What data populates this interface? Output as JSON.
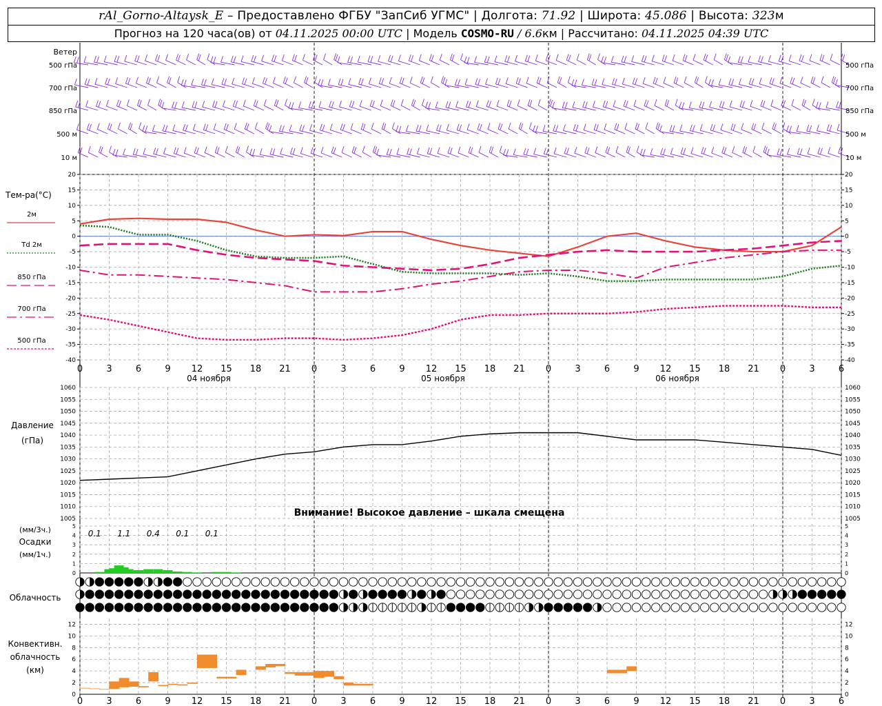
{
  "header": {
    "station": "rAl_Gorno-Altaysk_E",
    "provider_sep": " – ",
    "provider": "Предоставлено ФГБУ \"ЗапСиб УГМС\"",
    "sep": " | ",
    "lon_label": "Долгота: ",
    "lon_value": "71.92",
    "lat_label": "Широта: ",
    "lat_value": "45.086",
    "alt_label": "Высота: ",
    "alt_value": "323",
    "alt_unit": "м",
    "forecast_label": "Прогноз на 120 часа(ов)  от ",
    "forecast_start": "04.11.2025 00:00 UTC",
    "model_label": "Модель ",
    "model_name": "COSMO-RU",
    "model_res_sep": " / ",
    "model_res": "6.6",
    "model_res_unit": "км",
    "computed_label": "Рассчитано: ",
    "computed_value": "04.11.2025 04:39 UTC"
  },
  "wind": {
    "title": "Ветер",
    "levels": [
      "500 гПа",
      "700 гПа",
      "850 гПа",
      "500 м",
      "10  м"
    ],
    "barb_color": "#8a2be2"
  },
  "temperature": {
    "title": "Тем-ра(°C)",
    "legend": [
      {
        "label": "2м",
        "color": "#e8453c",
        "style": "solid"
      },
      {
        "label": "Td  2м",
        "color": "#1f7a1f",
        "style": "dotted"
      },
      {
        "label": "850 гПа",
        "color": "#e0127a",
        "style": "dash"
      },
      {
        "label": "700 гПа",
        "color": "#e0127a",
        "style": "dashdot"
      },
      {
        "label": "500 гПа",
        "color": "#e0127a",
        "style": "dot"
      }
    ],
    "y_ticks": [
      20,
      15,
      10,
      5,
      0,
      -5,
      -10,
      -15,
      -20,
      -25,
      -30,
      -35,
      -40
    ],
    "ylim": [
      -40,
      20
    ]
  },
  "time_axis": {
    "ticks": [
      "0",
      "3",
      "6",
      "9",
      "12",
      "15",
      "18",
      "21",
      "0",
      "3",
      "6",
      "9",
      "12",
      "15",
      "18",
      "21",
      "0",
      "3",
      "6",
      "9",
      "12",
      "15",
      "18",
      "21",
      "0",
      "3",
      "6"
    ],
    "day_labels": [
      "04 ноября",
      "05 ноября",
      "06 ноября"
    ]
  },
  "pressure": {
    "title": "Давление",
    "unit": "(гПа)",
    "y_ticks": [
      1060,
      1055,
      1050,
      1045,
      1040,
      1035,
      1030,
      1025,
      1020,
      1015,
      1010,
      1005
    ],
    "warning": "Внимание! Высокое давление – шкала смещена"
  },
  "precip": {
    "unit3": "(мм/3ч.)",
    "title": "Осадки",
    "unit1": "(мм/1ч.)",
    "totals": [
      "0.1",
      "1.1",
      "0.4",
      "0.1",
      "0.1"
    ],
    "y_ticks": [
      5,
      4,
      3,
      2,
      1,
      0
    ],
    "color": "#22cc22"
  },
  "cloud": {
    "title": "Облачность"
  },
  "convective": {
    "title_lines": [
      "Конвективн.",
      "облачность",
      "(км)"
    ],
    "y_ticks": [
      12,
      10,
      8,
      6,
      4,
      2,
      0
    ],
    "color": "#f08c2e"
  },
  "chart_data": [
    {
      "type": "line",
      "title": "Тем-ра(°C)",
      "x": [
        0,
        3,
        6,
        9,
        12,
        15,
        18,
        21,
        24,
        27,
        30,
        33,
        36,
        39,
        42,
        45,
        48,
        51,
        54,
        57,
        60,
        63,
        66,
        69,
        72,
        75,
        78
      ],
      "ylim": [
        -40,
        20
      ],
      "series": [
        {
          "name": "2м",
          "values": [
            4,
            5.5,
            5.8,
            5.5,
            5.5,
            4.5,
            2,
            0,
            0.5,
            0.2,
            1.5,
            1.5,
            -1,
            -3,
            -4.5,
            -5.5,
            -6.5,
            -3.5,
            0,
            1,
            -1.5,
            -3.5,
            -4.5,
            -5,
            -5,
            -3,
            3
          ]
        },
        {
          "name": "Td  2м",
          "values": [
            3.5,
            3,
            0.5,
            0.5,
            -1.5,
            -4.5,
            -6.5,
            -7,
            -7,
            -6.5,
            -9,
            -11.5,
            -12,
            -12,
            -12,
            -12.5,
            -12,
            -13,
            -14.5,
            -14.5,
            -14,
            -14,
            -14,
            -14,
            -13,
            -10.5,
            -9.5
          ]
        },
        {
          "name": "850 гПа",
          "values": [
            -3,
            -2.5,
            -2.5,
            -2.5,
            -4.5,
            -6,
            -7,
            -7.5,
            -8,
            -9.5,
            -10,
            -10.5,
            -11,
            -10.5,
            -9,
            -7,
            -6,
            -5,
            -4.5,
            -5,
            -5,
            -5,
            -4.5,
            -4,
            -3,
            -2,
            -1.5
          ]
        },
        {
          "name": "700 гПа",
          "values": [
            -11,
            -12.5,
            -12.5,
            -13,
            -13.5,
            -14,
            -15,
            -16,
            -18,
            -18,
            -18,
            -17,
            -15.5,
            -14.5,
            -13,
            -11.5,
            -11,
            -11,
            -12,
            -13.5,
            -10,
            -8.5,
            -7,
            -6,
            -5,
            -4.5,
            -4.5
          ]
        },
        {
          "name": "500 гПа",
          "values": [
            -25.5,
            -27,
            -29,
            -31,
            -33,
            -33.5,
            -33.5,
            -33,
            -33,
            -33.5,
            -33,
            -32,
            -30,
            -27,
            -25.5,
            -25.5,
            -25,
            -25,
            -25,
            -24.5,
            -23.5,
            -23,
            -22.5,
            -22.5,
            -22.5,
            -23,
            -23
          ]
        }
      ]
    },
    {
      "type": "line",
      "title": "Давление",
      "x": [
        0,
        3,
        6,
        9,
        12,
        15,
        18,
        21,
        24,
        27,
        30,
        33,
        36,
        39,
        42,
        45,
        48,
        51,
        54,
        57,
        60,
        63,
        66,
        69,
        72,
        75,
        78
      ],
      "ylim": [
        1005,
        1060
      ],
      "series": [
        {
          "values": [
            1021,
            1021.5,
            1022,
            1022.5,
            1025,
            1027.5,
            1030,
            1032,
            1033,
            1035,
            1036,
            1036,
            1037.5,
            1039.5,
            1040.5,
            1041,
            1041,
            1041,
            1039.5,
            1038,
            1038,
            1038,
            1037,
            1036,
            1035,
            1034,
            1031.5
          ]
        }
      ]
    },
    {
      "type": "bar",
      "title": "Осадки",
      "x": [
        2,
        3,
        3.5,
        4,
        4.5,
        5,
        6,
        7,
        8,
        9,
        10,
        11,
        12,
        14,
        15,
        16
      ],
      "ylim": [
        0,
        5
      ],
      "values": [
        0.1,
        0.4,
        0.5,
        0.8,
        0.6,
        0.4,
        0.3,
        0.4,
        0.4,
        0.3,
        0.15,
        0.1,
        0.05,
        0.1,
        0.1,
        0.05
      ]
    },
    {
      "type": "bar",
      "title": "Конвективн. облачность (км)",
      "ylim": [
        0,
        13
      ],
      "x": [
        0,
        1,
        2,
        3,
        4,
        5,
        6,
        7,
        8,
        9,
        10,
        11,
        12,
        13,
        14,
        15,
        16,
        17,
        18,
        19,
        20,
        21,
        22,
        23,
        24,
        25,
        26,
        27,
        28,
        29,
        54,
        55,
        56
      ],
      "values": [
        [
          1,
          1.1
        ],
        [
          0.9,
          1
        ],
        [
          0.8,
          0.9
        ],
        [
          0.9,
          2.2
        ],
        [
          1.2,
          2.8
        ],
        [
          1.3,
          2.2
        ],
        [
          1.2,
          1.4
        ],
        [
          2.2,
          3.8
        ],
        [
          1.4,
          1.6
        ],
        [
          1.6,
          1.8
        ],
        [
          1.5,
          1.7
        ],
        [
          1.8,
          2
        ],
        [
          4.5,
          6.8
        ],
        [
          4.5,
          6.8
        ],
        [
          2.7,
          3
        ],
        [
          2.7,
          3
        ],
        [
          3.3,
          4.2
        ],
        [
          0,
          0
        ],
        [
          4.2,
          4.8
        ],
        [
          4.6,
          5.2
        ],
        [
          4.8,
          5.2
        ],
        [
          3.5,
          3.8
        ],
        [
          3.2,
          3.8
        ],
        [
          3.2,
          3.8
        ],
        [
          2.8,
          4
        ],
        [
          3,
          4
        ],
        [
          2.6,
          3.1
        ],
        [
          1.5,
          2
        ],
        [
          1.5,
          1.8
        ],
        [
          1.5,
          1.8
        ],
        [
          3.6,
          4.2
        ],
        [
          3.6,
          4.2
        ],
        [
          4,
          4.8
        ]
      ]
    }
  ]
}
